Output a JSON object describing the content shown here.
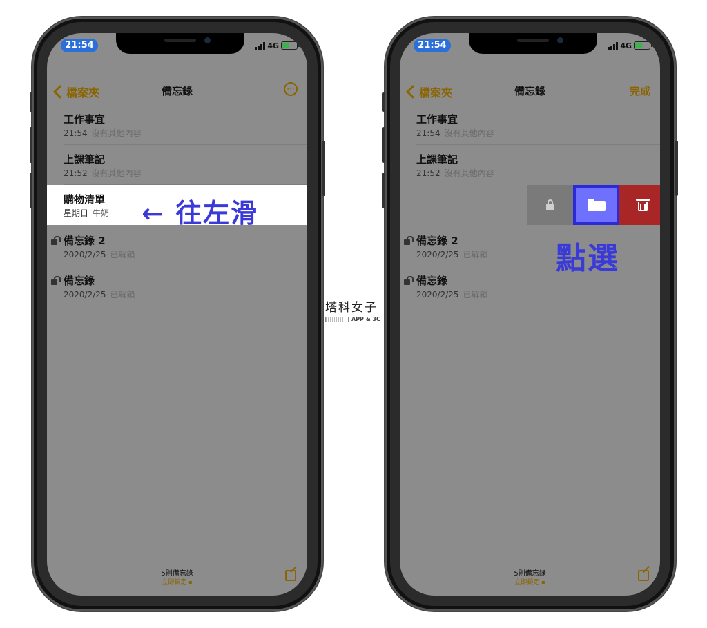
{
  "left_phone": {
    "status": {
      "time": "21:54",
      "network": "4G"
    },
    "nav": {
      "back_label": "檔案夾",
      "title": "備忘錄",
      "more_icon": "ellipsis-circle-icon"
    },
    "notes": [
      {
        "title": "工作事宜",
        "date": "21:54",
        "preview": "沒有其他內容",
        "locked": false
      },
      {
        "title": "上課筆記",
        "date": "21:52",
        "preview": "沒有其他內容",
        "locked": false
      },
      {
        "title": "購物清單",
        "date": "星期日",
        "preview": "牛奶",
        "locked": false
      },
      {
        "title": "備忘錄 2",
        "date": "2020/2/25",
        "preview": "已解鎖",
        "locked": true
      },
      {
        "title": "備忘錄",
        "date": "2020/2/25",
        "preview": "已解鎖",
        "locked": true
      }
    ],
    "annotation": "← 往左滑",
    "footer": {
      "count": "5則備忘錄",
      "lock_now": "立即鎖定"
    }
  },
  "right_phone": {
    "status": {
      "time": "21:54",
      "network": "4G"
    },
    "nav": {
      "back_label": "檔案夾",
      "title": "備忘錄",
      "done_label": "完成"
    },
    "notes": [
      {
        "title": "工作事宜",
        "date": "21:54",
        "preview": "沒有其他內容",
        "locked": false
      },
      {
        "title": "上課筆記",
        "date": "21:52",
        "preview": "沒有其他內容",
        "locked": false
      },
      {
        "title": "備忘錄 2",
        "date": "2020/2/25",
        "preview": "已解鎖",
        "locked": true
      },
      {
        "title": "備忘錄",
        "date": "2020/2/25",
        "preview": "已解鎖",
        "locked": true
      }
    ],
    "swipe_actions": [
      "lock-icon",
      "folder-icon",
      "trash-icon"
    ],
    "annotation": "點選",
    "footer": {
      "count": "5則備忘錄",
      "lock_now": "立即鎖定"
    }
  },
  "watermark": {
    "title": "塔科女子",
    "subtitle": "APP & 3C"
  },
  "colors": {
    "accent": "#8a6400",
    "annotation": "#3a3ad8",
    "delete": "#a82626",
    "move_highlight": "#7070ff"
  }
}
